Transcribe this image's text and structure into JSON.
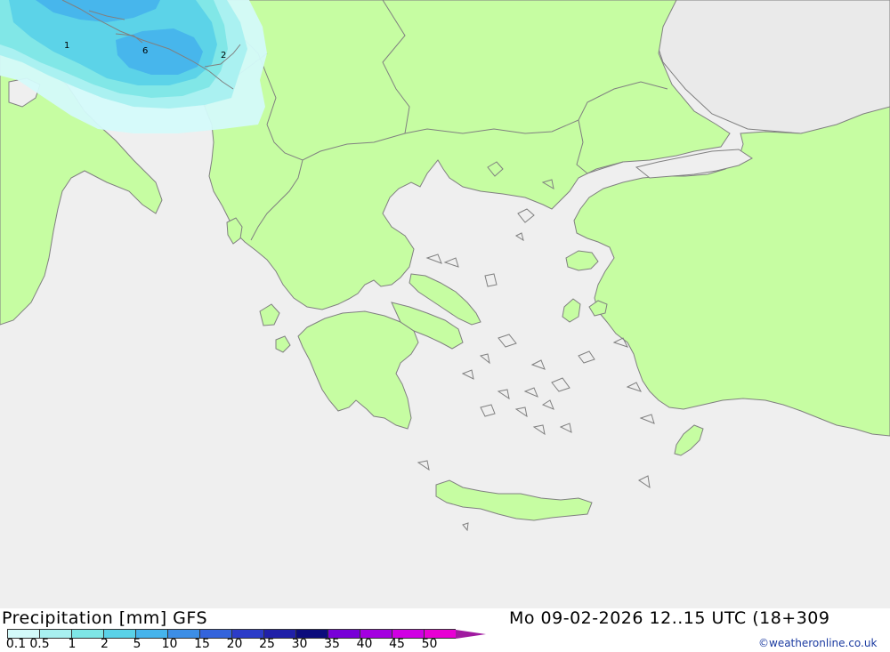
{
  "map": {
    "colors": {
      "sea": "#efefef",
      "land": "#c6fda2",
      "coast": "#808080",
      "border": "#808080",
      "outside": "#e8e8e8"
    },
    "contour_labels": [
      {
        "text": "1"
      },
      {
        "text": "6"
      },
      {
        "text": "2"
      }
    ]
  },
  "footer": {
    "title": "Precipitation [mm] GFS",
    "datetime": "Mo 09-02-2026 12..15 UTC (18+309",
    "credit": "©weatheronline.co.uk"
  },
  "legend": {
    "labels": [
      "0.1",
      "0.5",
      "1",
      "2",
      "5",
      "10",
      "15",
      "20",
      "25",
      "30",
      "35",
      "40",
      "45",
      "50"
    ],
    "colors": [
      "#d4fafa",
      "#a8f0f0",
      "#7ee6e6",
      "#5ad2e8",
      "#46b4ec",
      "#3c8ee6",
      "#3464dc",
      "#2c3cc8",
      "#2020a8",
      "#0c0c7c",
      "#7800d8",
      "#a400e0",
      "#d000e4",
      "#e800d4",
      "#a01aa0"
    ]
  }
}
